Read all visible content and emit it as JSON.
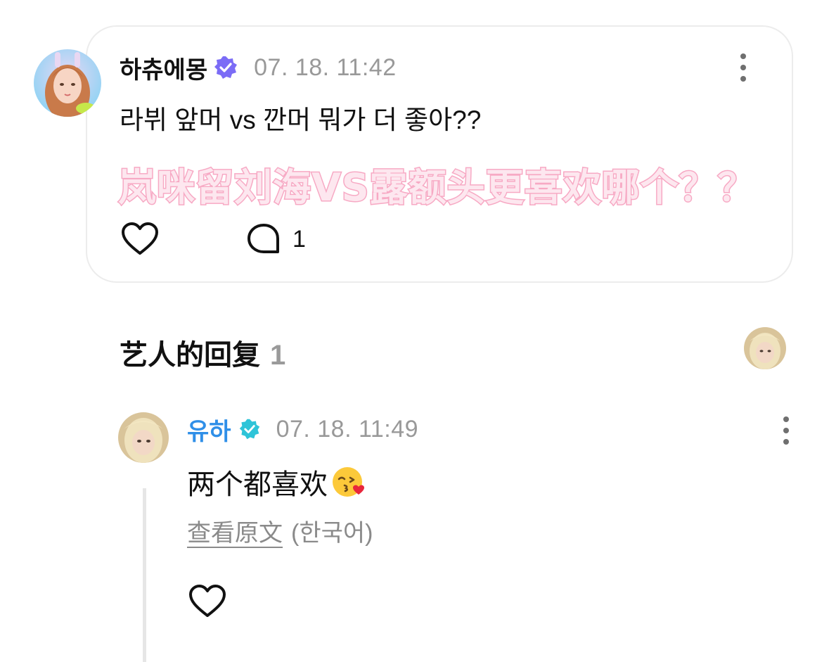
{
  "post": {
    "author": "하츄에몽",
    "timestamp": "07. 18. 11:42",
    "text": "라뷔 앞머 vs 깐머 뭐가 더 좋아??",
    "overlay_caption": "岚咪留刘海VS露额头更喜欢哪个？？",
    "comment_count": "1",
    "verified_badge_color": "#7b6cf6"
  },
  "artist_replies": {
    "title": "艺人的回复",
    "count": "1"
  },
  "reply": {
    "author": "유하",
    "timestamp": "07. 18. 11:49",
    "text": "两个都喜欢",
    "emoji": "kissing-face-with-heart",
    "view_original": "查看原文",
    "original_language": "(한국어)",
    "author_color": "#2f8fe8",
    "verified_badge_color": "#2ec4d8"
  }
}
